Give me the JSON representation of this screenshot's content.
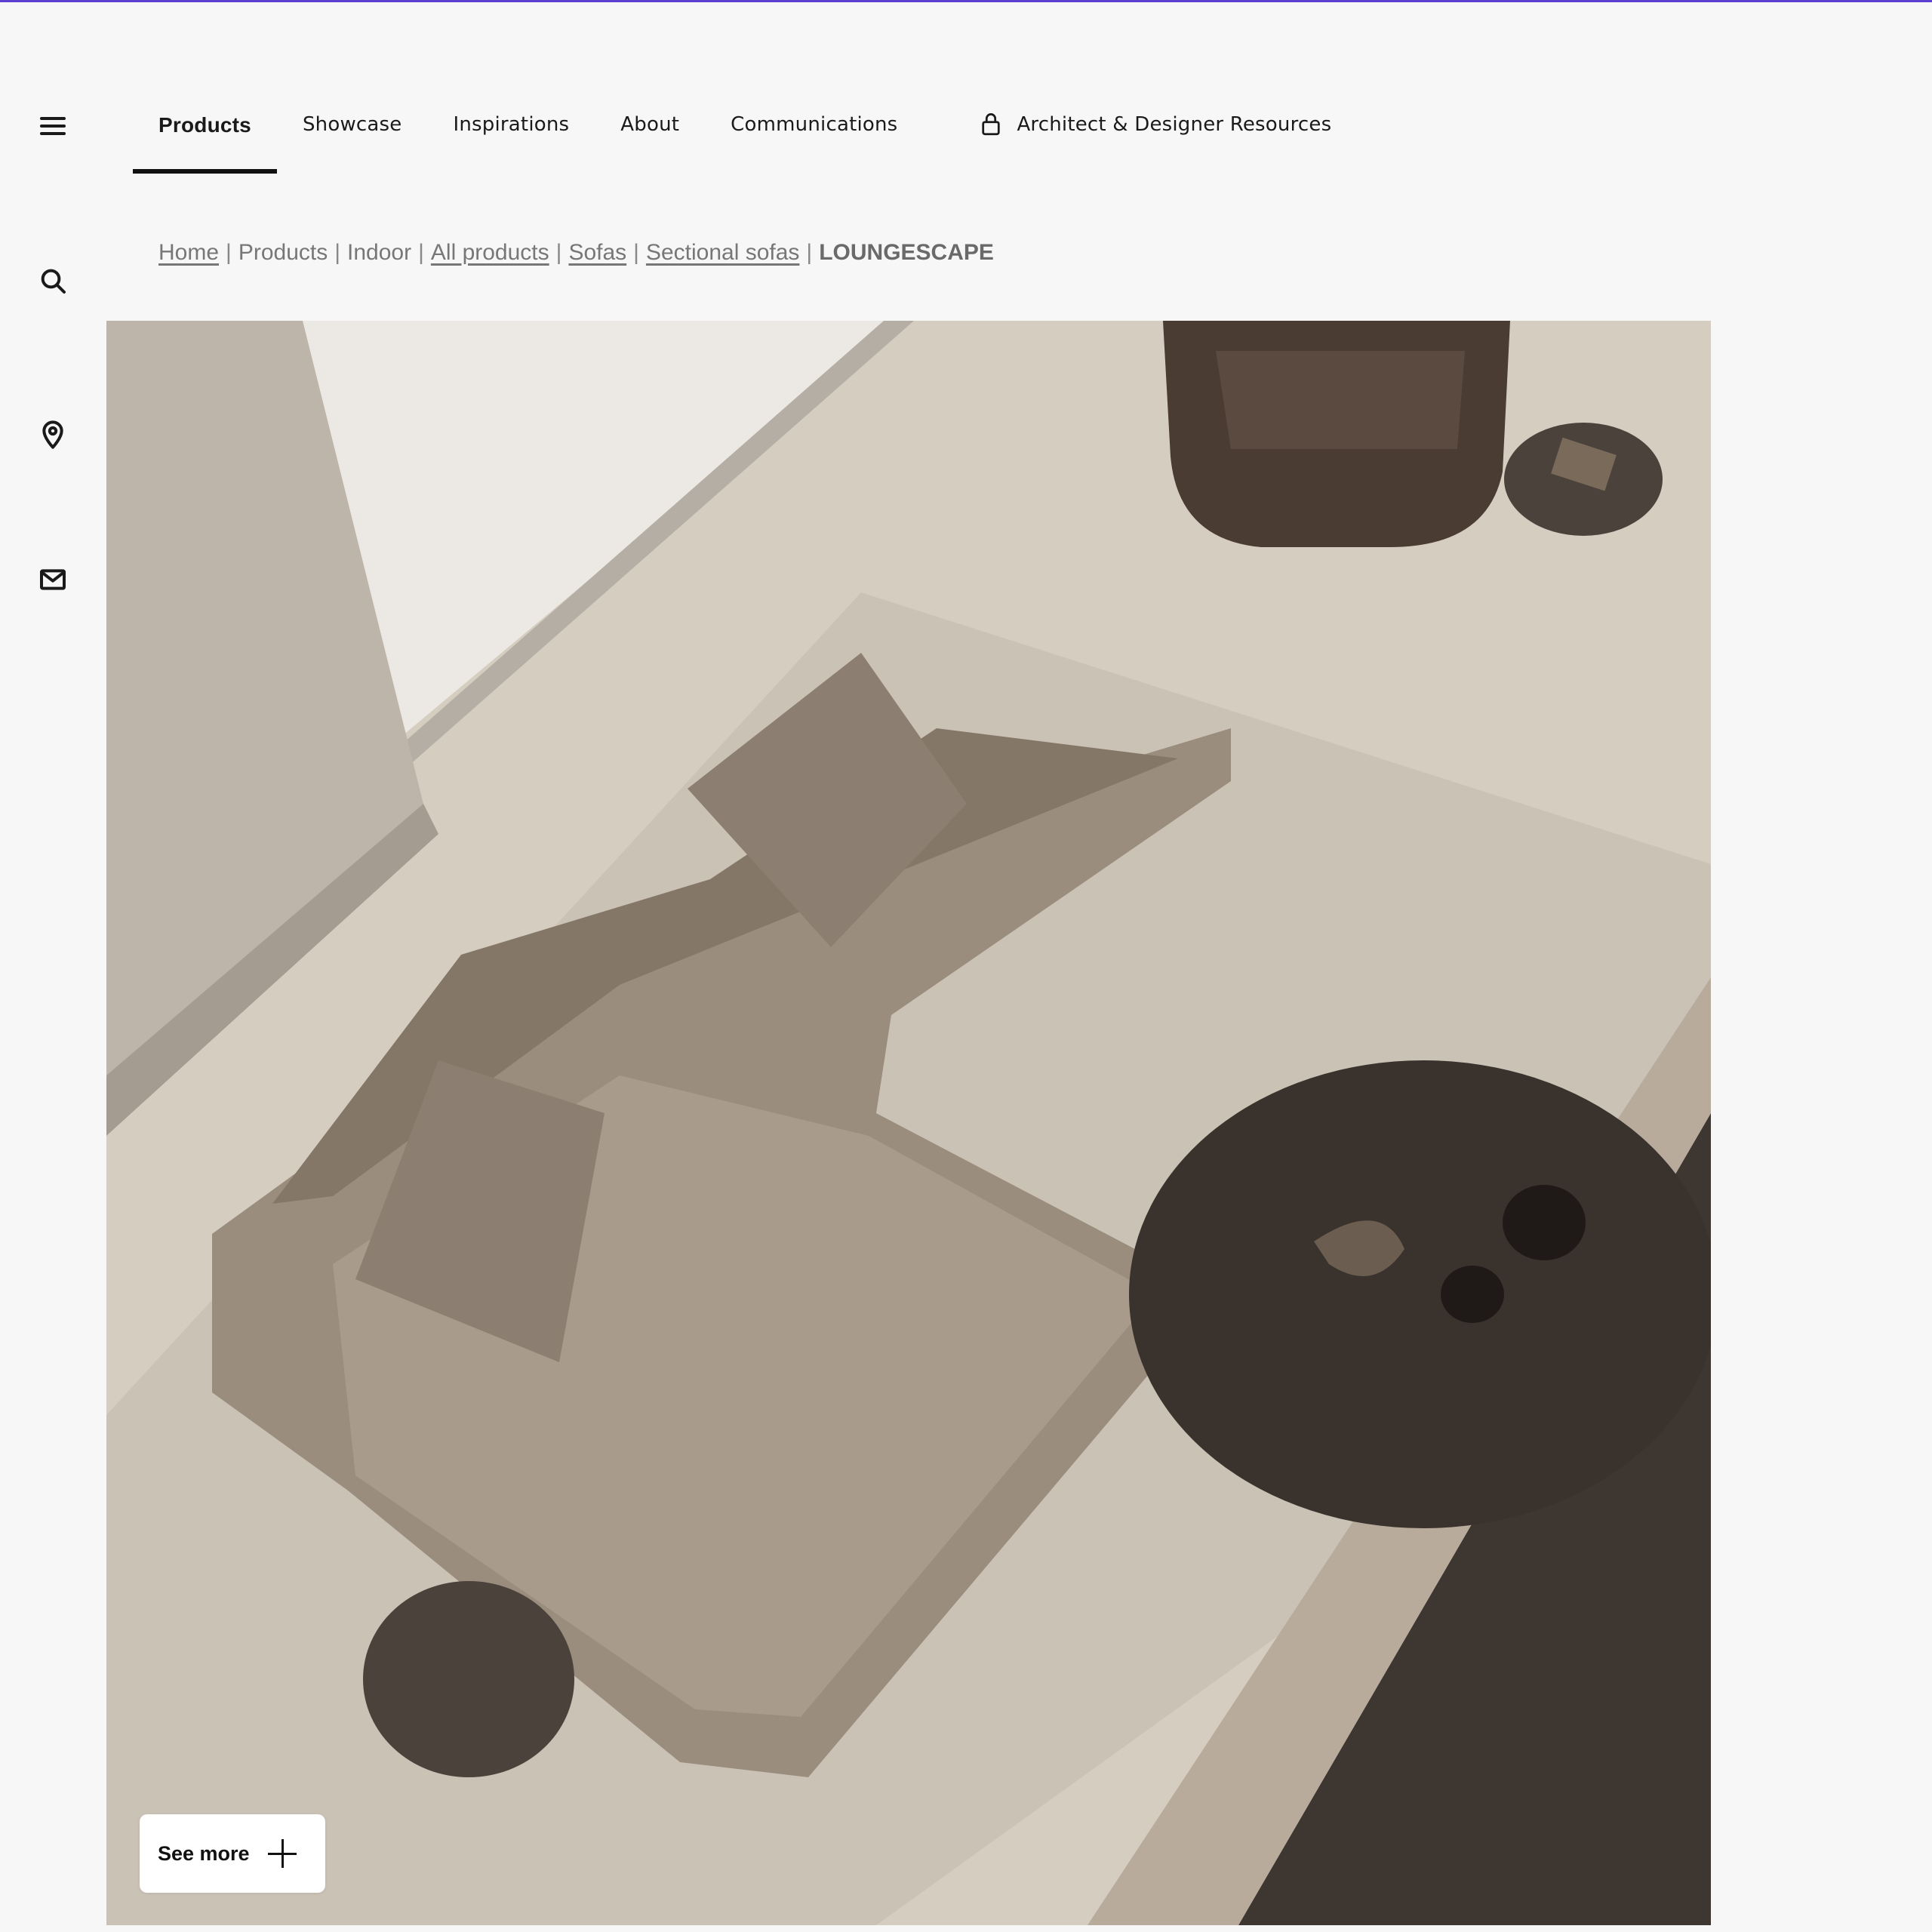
{
  "icons": {
    "menu": "menu-icon",
    "search": "search-icon",
    "location": "location-pin-icon",
    "mail": "mail-icon",
    "lock": "lock-icon",
    "plus": "plus-icon"
  },
  "nav": {
    "items": [
      {
        "label": "Products",
        "active": true
      },
      {
        "label": "Showcase"
      },
      {
        "label": "Inspirations"
      },
      {
        "label": "About"
      },
      {
        "label": "Communications"
      },
      {
        "label": "Architect & Designer Resources",
        "locked": true
      }
    ]
  },
  "breadcrumb": {
    "items": [
      {
        "label": "Home",
        "link": true
      },
      {
        "label": "Products",
        "link": false
      },
      {
        "label": "Indoor",
        "link": false
      },
      {
        "label": "All products",
        "link": true
      },
      {
        "label": "Sofas",
        "link": true
      },
      {
        "label": "Sectional sofas",
        "link": true
      },
      {
        "label": "LOUNGESCAPE",
        "current": true
      }
    ],
    "separator": "|"
  },
  "hero": {
    "see_more_label": "See more"
  },
  "colors": {
    "accent_bar": "#5b3fd0",
    "background": "#f7f7f7"
  }
}
